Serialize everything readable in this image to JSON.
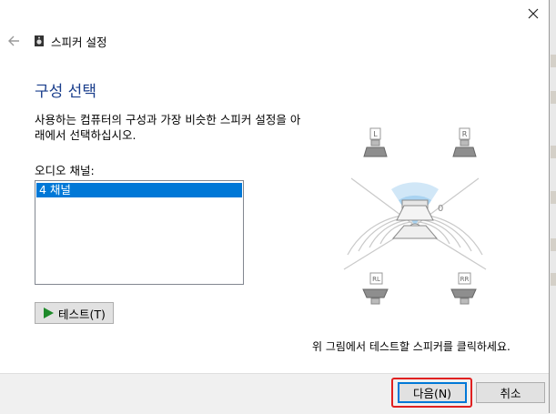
{
  "window": {
    "title": "스피커 설정"
  },
  "page": {
    "heading": "구성 선택",
    "description": "사용하는 컴퓨터의 구성과 가장 비슷한 스피커 설정을 아래에서 선택하십시오.",
    "channel_label": "오디오 채널:",
    "channels": [
      {
        "label": "4 채널",
        "selected": true
      }
    ],
    "test_button": "테스트(T)",
    "hint": "위 그림에서 테스트할 스피커를 클릭하세요."
  },
  "diagram": {
    "speakers": [
      {
        "id": "front-left",
        "label": "L"
      },
      {
        "id": "front-right",
        "label": "R"
      },
      {
        "id": "rear-left",
        "label": "RL"
      },
      {
        "id": "rear-right",
        "label": "RR"
      }
    ],
    "listener_marker": "0"
  },
  "footer": {
    "next_button": "다음(N)",
    "cancel_button": "취소"
  },
  "colors": {
    "heading": "#1a3e8c",
    "selection": "#0078d7",
    "highlight": "#e02020",
    "play": "#1e8a2a"
  }
}
